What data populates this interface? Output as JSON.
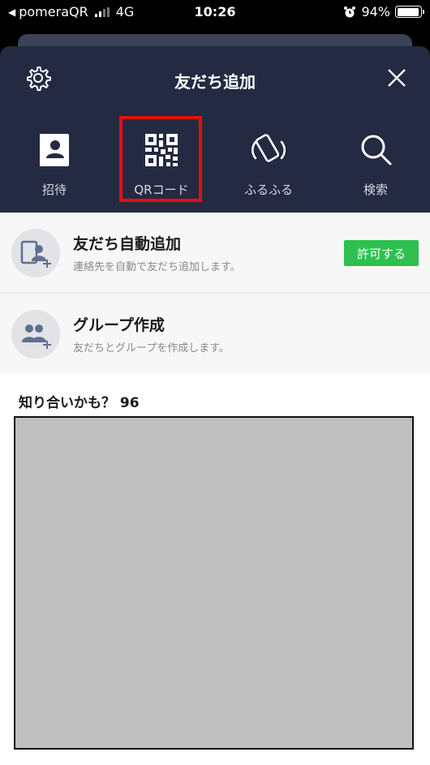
{
  "status_bar": {
    "back_indicator": "◀",
    "carrier": "pomeraQR",
    "network": "4G",
    "time": "10:26",
    "alarm_icon": "alarm-clock-icon",
    "battery_percent": "94%",
    "battery_level": 0.94
  },
  "header": {
    "title": "友だち追加",
    "settings_icon": "gear-icon",
    "close_icon": "close-icon",
    "colors": {
      "background": "#232a42",
      "highlight": "#e31010"
    }
  },
  "tabs": [
    {
      "label": "招待",
      "icon": "contact-book-icon"
    },
    {
      "label": "QRコード",
      "icon": "qr-code-icon"
    },
    {
      "label": "ふるふる",
      "icon": "shake-phone-icon"
    },
    {
      "label": "検索",
      "icon": "search-icon"
    }
  ],
  "list": {
    "auto_add": {
      "title": "友だち自動追加",
      "subtitle": "連絡先を自動で友だち追加します。",
      "button_label": "許可する",
      "icon": "add-contact-icon",
      "button_color": "#2ebf4f"
    },
    "group": {
      "title": "グループ作成",
      "subtitle": "友だちとグループを作成します。",
      "icon": "add-group-icon"
    }
  },
  "suggestions": {
    "title": "知り合いかも？ 96"
  }
}
